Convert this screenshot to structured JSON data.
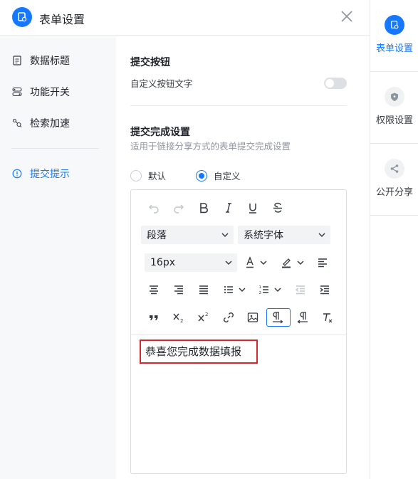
{
  "header": {
    "title": "表单设置"
  },
  "sidebar": {
    "items": [
      {
        "label": "数据标题",
        "icon": "document-icon"
      },
      {
        "label": "功能开关",
        "icon": "toggle-icon"
      },
      {
        "label": "检索加速",
        "icon": "search-graph-icon"
      },
      {
        "label": "提交提示",
        "icon": "info-circle-icon",
        "active": true
      }
    ]
  },
  "main": {
    "submit_button": {
      "title": "提交按钮",
      "custom_label": "自定义按钮文字",
      "toggle_on": false
    },
    "completion": {
      "title": "提交完成设置",
      "subtitle": "适用于链接分享方式的表单提交完成设置",
      "options": [
        {
          "label": "默认",
          "checked": false
        },
        {
          "label": "自定义",
          "checked": true
        }
      ]
    },
    "editor": {
      "paragraph_select": "段落",
      "font_select": "系统字体",
      "size_select": "16px",
      "content": "恭喜您完成数据填报"
    }
  },
  "right_panel": {
    "items": [
      {
        "label": "表单设置",
        "active": true
      },
      {
        "label": "权限设置",
        "active": false
      },
      {
        "label": "公开分享",
        "active": false
      }
    ]
  },
  "colors": {
    "accent": "#1677ff",
    "highlight_border": "#d9262c"
  }
}
